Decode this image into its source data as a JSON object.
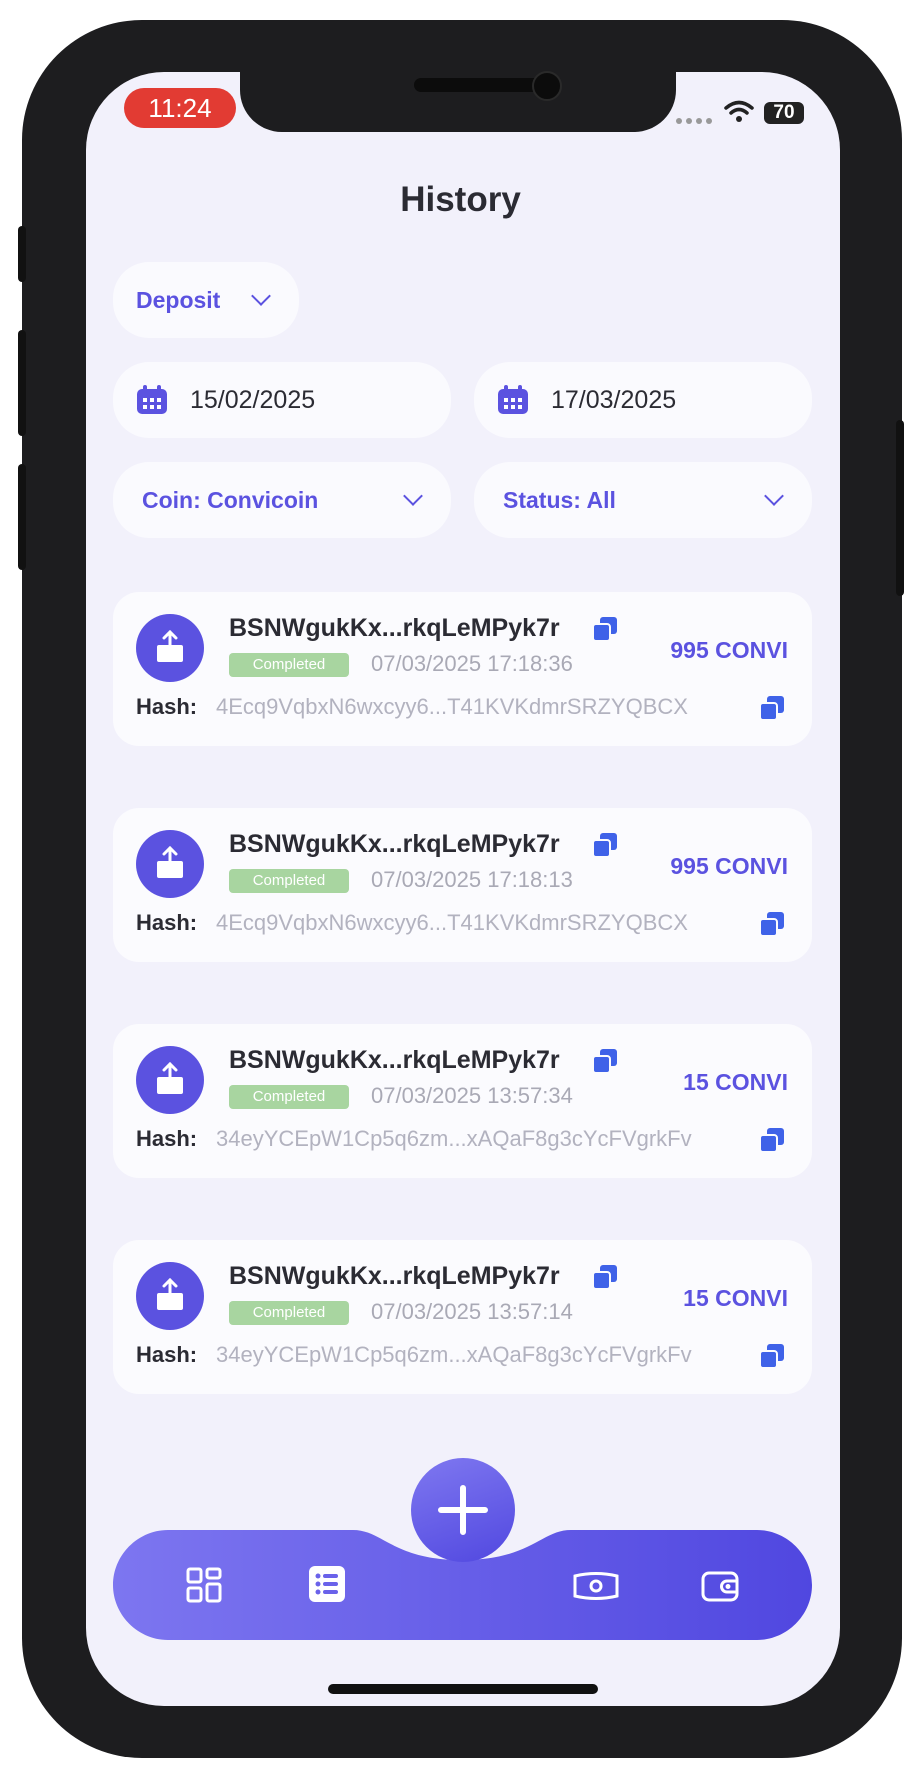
{
  "status_bar": {
    "time": "11:24",
    "battery": "70"
  },
  "header": {
    "title": "History"
  },
  "filters": {
    "type": "Deposit",
    "date_from": "15/02/2025",
    "date_to": "17/03/2025",
    "coin": "Coin: Convicoin",
    "status": "Status: All"
  },
  "transactions": [
    {
      "address": "BSNWgukKx...rkqLeMPyk7r",
      "status": "Completed",
      "timestamp": "07/03/2025 17:18:36",
      "amount": "995 CONVI",
      "hash_label": "Hash:",
      "hash": "4Ecq9VqbxN6wxcyy6...T41KVKdmrSRZYQBCX"
    },
    {
      "address": "BSNWgukKx...rkqLeMPyk7r",
      "status": "Completed",
      "timestamp": "07/03/2025 17:18:13",
      "amount": "995 CONVI",
      "hash_label": "Hash:",
      "hash": "4Ecq9VqbxN6wxcyy6...T41KVKdmrSRZYQBCX"
    },
    {
      "address": "BSNWgukKx...rkqLeMPyk7r",
      "status": "Completed",
      "timestamp": "07/03/2025 13:57:34",
      "amount": "15 CONVI",
      "hash_label": "Hash:",
      "hash": "34eyYCEpW1Cp5q6zm...xAQaF8g3cYcFVgrkFv"
    },
    {
      "address": "BSNWgukKx...rkqLeMPyk7r",
      "status": "Completed",
      "timestamp": "07/03/2025 13:57:14",
      "amount": "15 CONVI",
      "hash_label": "Hash:",
      "hash": "34eyYCEpW1Cp5q6zm...xAQaF8g3cYcFVgrkFv"
    }
  ],
  "nav": {
    "items": [
      "dashboard-icon",
      "history-list-icon",
      "money-icon",
      "wallet-icon"
    ],
    "active": "history-list-icon",
    "fab": "plus-icon"
  },
  "colors": {
    "accent": "#5b52e0",
    "badge": "#a8d5a0",
    "background": "#f2f1fb"
  }
}
